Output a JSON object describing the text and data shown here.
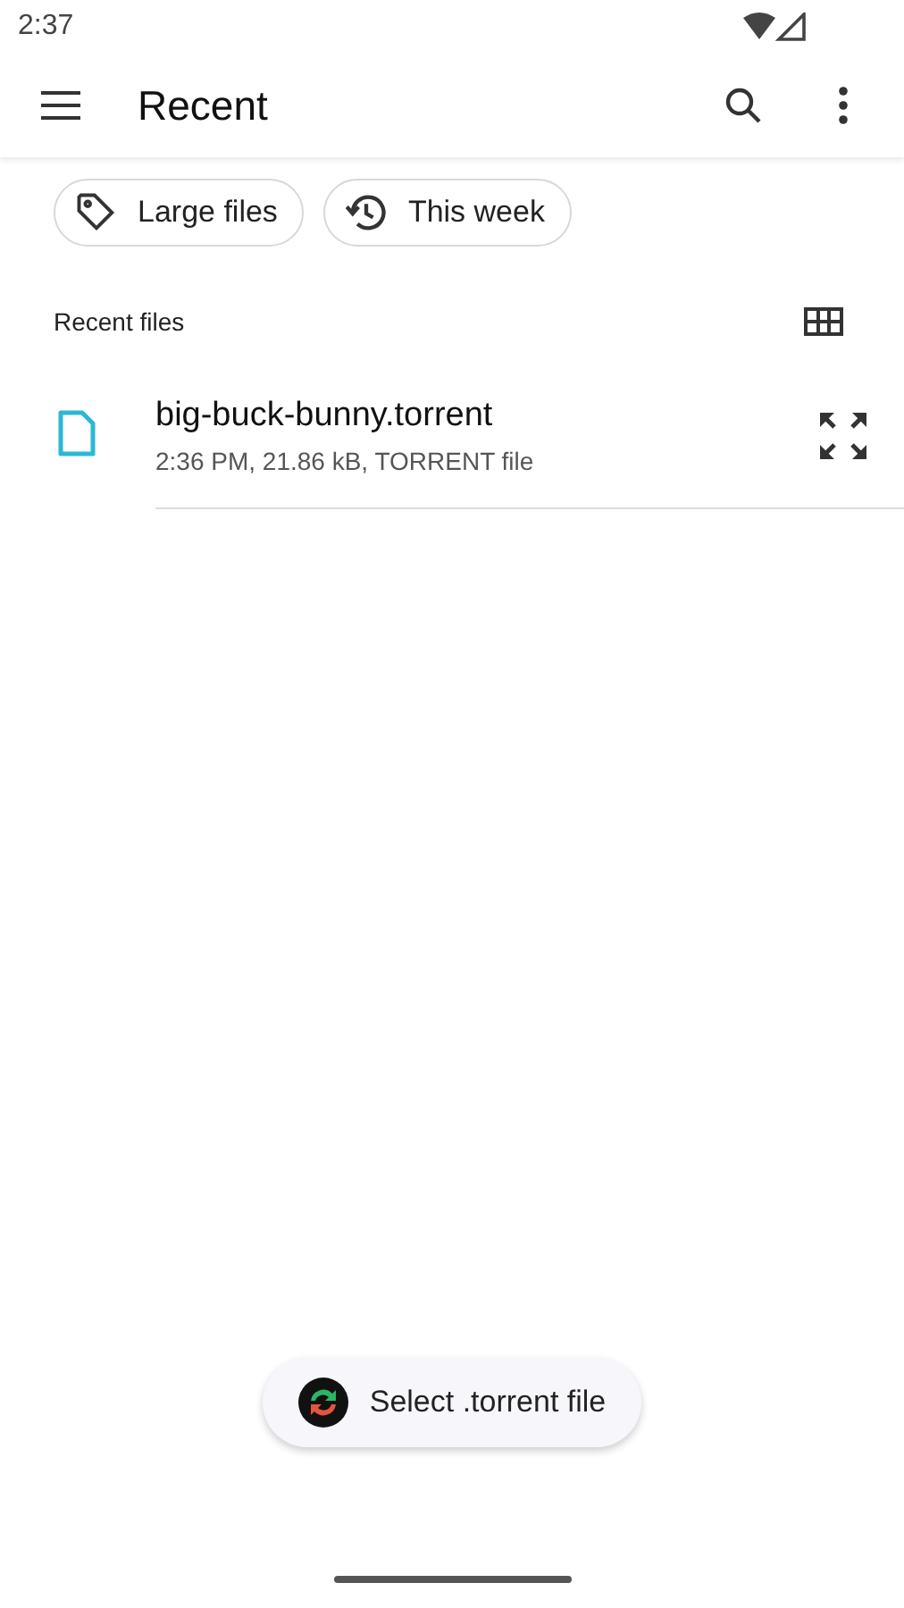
{
  "status_bar": {
    "time": "2:37"
  },
  "app_bar": {
    "title": "Recent"
  },
  "chips": [
    {
      "label": "Large files",
      "kind": "tag"
    },
    {
      "label": "This week",
      "kind": "history"
    }
  ],
  "section": {
    "title": "Recent files"
  },
  "files": [
    {
      "name": "big-buck-bunny.torrent",
      "details": "2:36 PM, 21.86 kB, TORRENT file"
    }
  ],
  "toast": {
    "label": "Select .torrent file"
  }
}
